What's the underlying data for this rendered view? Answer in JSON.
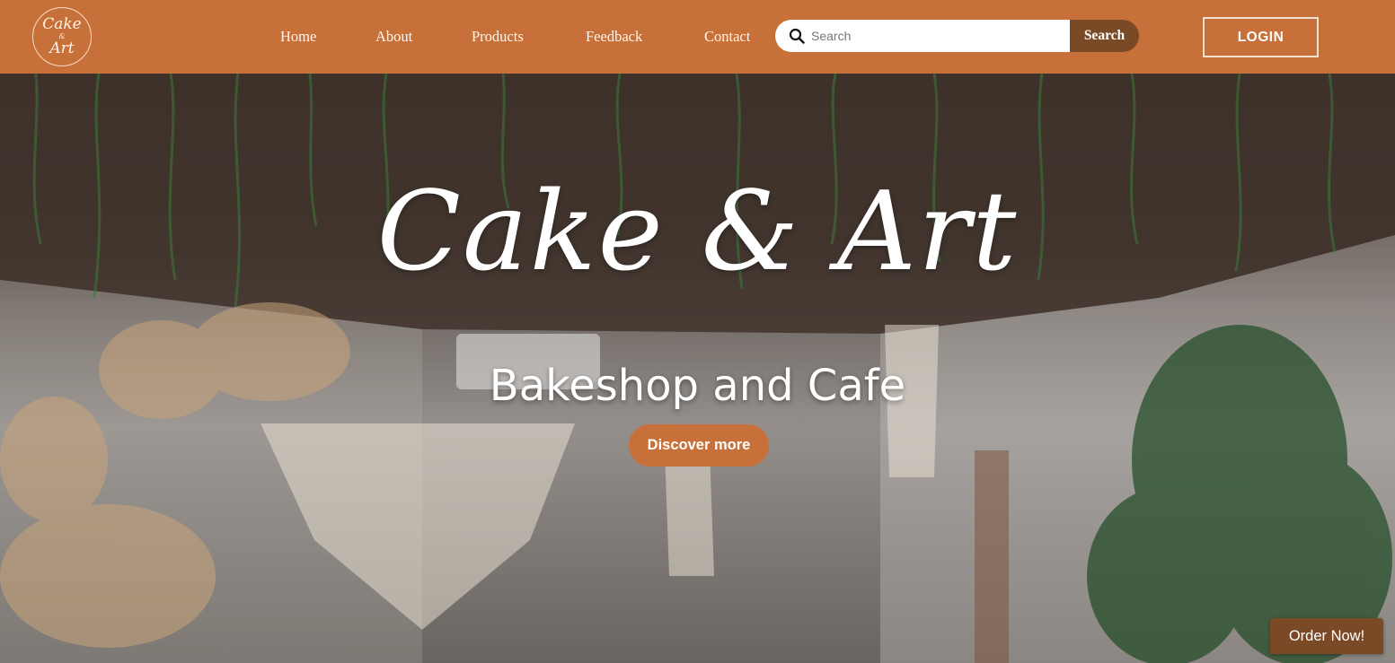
{
  "logo": {
    "line1": "Cake",
    "amp": "&",
    "line2": "Art",
    "icon": "logo-badge"
  },
  "nav": {
    "items": [
      "Home",
      "About",
      "Products",
      "Feedback",
      "Contact"
    ]
  },
  "search": {
    "placeholder": "Search",
    "value": "",
    "button_label": "Search",
    "icon": "search-icon"
  },
  "login": {
    "label": "LOGIN"
  },
  "hero": {
    "title": "Cake & Art",
    "subtitle": "Bakeshop and Cafe",
    "cta_label": "Discover more"
  },
  "order": {
    "label": "Order Now!"
  },
  "colors": {
    "header_bg": "#c8703a",
    "accent_dark": "#7a4a26",
    "text_light": "#ffffff"
  }
}
